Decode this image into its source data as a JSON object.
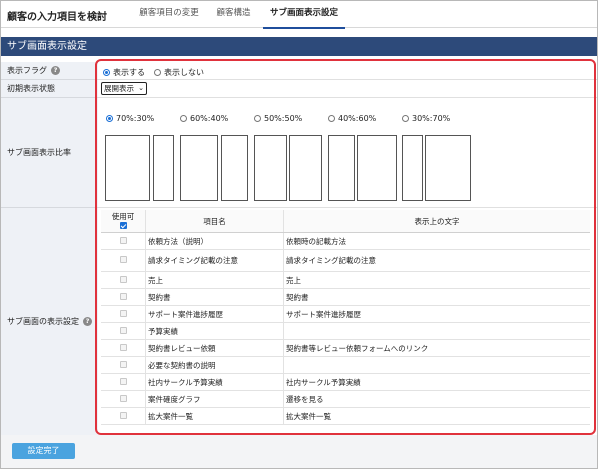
{
  "header": {
    "title": "顧客の入力項目を検討",
    "tabs": [
      {
        "label": "顧客項目の変更",
        "active": false
      },
      {
        "label": "顧客構造",
        "active": false
      },
      {
        "label": "サブ画面表示設定",
        "active": true
      }
    ]
  },
  "section_title": "サブ画面表示設定",
  "rows": {
    "display_flag": {
      "label": "表示フラグ",
      "options": [
        "表示する",
        "表示しない"
      ],
      "selected": "表示する"
    },
    "initial_state": {
      "label": "初期表示状態",
      "value": "展開表示"
    },
    "ratio": {
      "label": "サブ画面表示比率",
      "options": [
        "70%:30%",
        "60%:40%",
        "50%:50%",
        "40%:60%",
        "30%:70%"
      ],
      "selected": "70%:30%"
    },
    "items": {
      "label": "サブ画面の表示設定",
      "columns": [
        "使用可",
        "項目名",
        "表示上の文字"
      ],
      "header_checked": true,
      "rows": [
        {
          "name": "依頼方法（説明）",
          "display": "依頼時の記載方法"
        },
        {
          "name": "請求タイミング記載の注意",
          "display": "請求タイミング記載の注意"
        },
        {
          "name": "売上",
          "display": "売上"
        },
        {
          "name": "契約書",
          "display": "契約書"
        },
        {
          "name": "サポート案件進捗履歴",
          "display": "サポート案件進捗履歴"
        },
        {
          "name": "予算実績",
          "display": ""
        },
        {
          "name": "契約書レビュー依頼",
          "display": "契約書等レビュー依頼フォームへのリンク"
        },
        {
          "name": "必要な契約書の説明",
          "display": ""
        },
        {
          "name": "社内サークル予算実績",
          "display": "社内サークル予算実績"
        },
        {
          "name": "案件確度グラフ",
          "display": "遷移を見る"
        },
        {
          "name": "拡大案件一覧",
          "display": "拡大案件一覧"
        }
      ]
    }
  },
  "footer": {
    "done_label": "設定完了"
  },
  "colors": {
    "header_bg": "#2d4a7a",
    "accent": "#1a6fd6",
    "outline": "#e0323c",
    "button": "#4aa3df"
  }
}
